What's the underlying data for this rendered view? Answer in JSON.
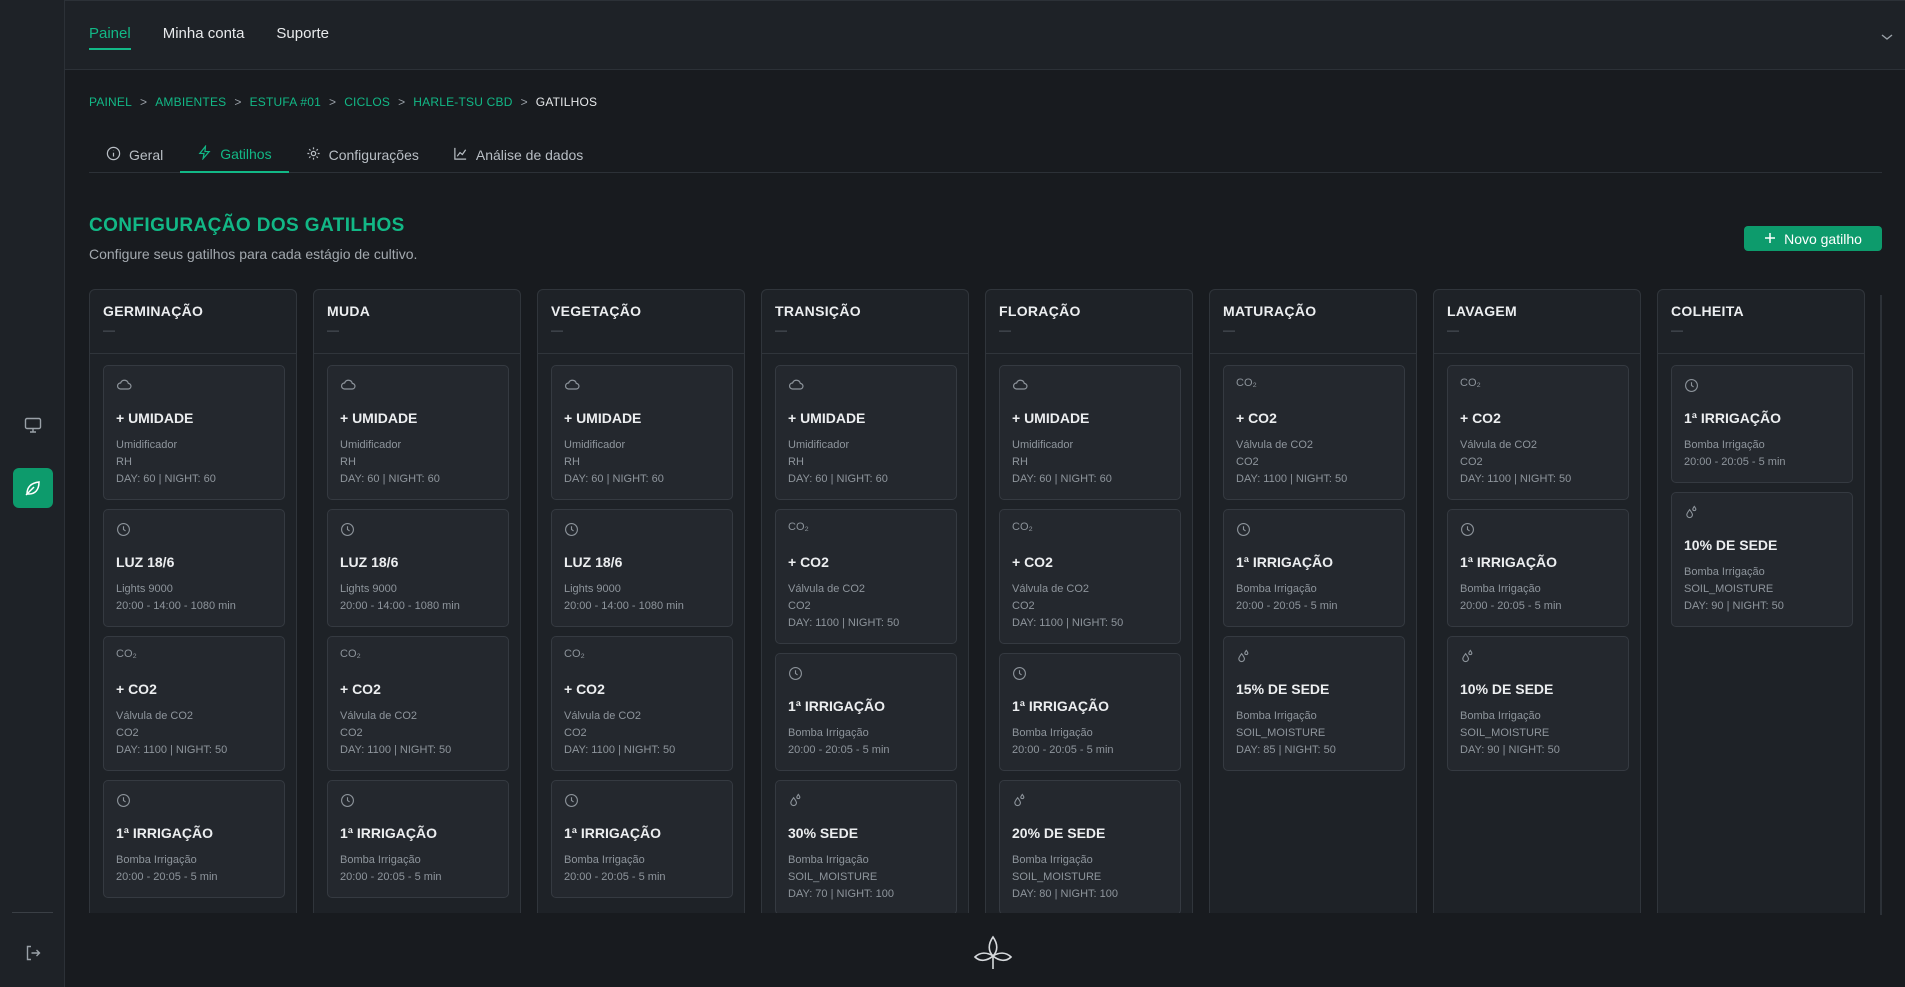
{
  "topnav": {
    "items": [
      "Painel",
      "Minha conta",
      "Suporte"
    ]
  },
  "breadcrumb": [
    "PAINEL",
    "AMBIENTES",
    "ESTUFA #01",
    "CICLOS",
    "HARLE-TSU CBD",
    "GATILHOS"
  ],
  "breadcrumb_sep": ">",
  "tabs": [
    "Geral",
    "Gatilhos",
    "Configurações",
    "Análise de dados"
  ],
  "page": {
    "title": "CONFIGURAÇÃO DOS GATILHOS",
    "subtitle": "Configure seus gatilhos para cada estágio de cultivo.",
    "new_button": "Novo gatilho"
  },
  "accent_color": "#12b886",
  "columns": [
    {
      "title": "GERMINAÇÃO",
      "dash": "—",
      "cards": [
        {
          "icon": "cloud-icon",
          "title": "+ UMIDADE",
          "lines": [
            "Umidificador",
            "RH",
            "DAY: 60 | NIGHT: 60"
          ]
        },
        {
          "icon": "clock-icon",
          "title": "LUZ 18/6",
          "lines": [
            "Lights 9000",
            "20:00 - 14:00 - 1080 min"
          ]
        },
        {
          "icon": "co2-icon",
          "icon_text": "CO₂",
          "title": "+ CO2",
          "lines": [
            "Válvula de CO2",
            "CO2",
            "DAY: 1100 | NIGHT: 50"
          ]
        },
        {
          "icon": "clock-icon",
          "title": "1ª IRRIGAÇÃO",
          "lines": [
            "Bomba Irrigação",
            "20:00 - 20:05 - 5 min"
          ]
        }
      ]
    },
    {
      "title": "MUDA",
      "dash": "—",
      "cards": [
        {
          "icon": "cloud-icon",
          "title": "+ UMIDADE",
          "lines": [
            "Umidificador",
            "RH",
            "DAY: 60 | NIGHT: 60"
          ]
        },
        {
          "icon": "clock-icon",
          "title": "LUZ 18/6",
          "lines": [
            "Lights 9000",
            "20:00 - 14:00 - 1080 min"
          ]
        },
        {
          "icon": "co2-icon",
          "icon_text": "CO₂",
          "title": "+ CO2",
          "lines": [
            "Válvula de CO2",
            "CO2",
            "DAY: 1100 | NIGHT: 50"
          ]
        },
        {
          "icon": "clock-icon",
          "title": "1ª IRRIGAÇÃO",
          "lines": [
            "Bomba Irrigação",
            "20:00 - 20:05 - 5 min"
          ]
        }
      ]
    },
    {
      "title": "VEGETAÇÃO",
      "dash": "—",
      "cards": [
        {
          "icon": "cloud-icon",
          "title": "+ UMIDADE",
          "lines": [
            "Umidificador",
            "RH",
            "DAY: 60 | NIGHT: 60"
          ]
        },
        {
          "icon": "clock-icon",
          "title": "LUZ 18/6",
          "lines": [
            "Lights 9000",
            "20:00 - 14:00 - 1080 min"
          ]
        },
        {
          "icon": "co2-icon",
          "icon_text": "CO₂",
          "title": "+ CO2",
          "lines": [
            "Válvula de CO2",
            "CO2",
            "DAY: 1100 | NIGHT: 50"
          ]
        },
        {
          "icon": "clock-icon",
          "title": "1ª IRRIGAÇÃO",
          "lines": [
            "Bomba Irrigação",
            "20:00 - 20:05 - 5 min"
          ]
        }
      ]
    },
    {
      "title": "TRANSIÇÃO",
      "dash": "—",
      "cards": [
        {
          "icon": "cloud-icon",
          "title": "+ UMIDADE",
          "lines": [
            "Umidificador",
            "RH",
            "DAY: 60 | NIGHT: 60"
          ]
        },
        {
          "icon": "co2-icon",
          "icon_text": "CO₂",
          "title": "+ CO2",
          "lines": [
            "Válvula de CO2",
            "CO2",
            "DAY: 1100 | NIGHT: 50"
          ]
        },
        {
          "icon": "clock-icon",
          "title": "1ª IRRIGAÇÃO",
          "lines": [
            "Bomba Irrigação",
            "20:00 - 20:05 - 5 min"
          ]
        },
        {
          "icon": "drops-icon",
          "title": "30% SEDE",
          "lines": [
            "Bomba Irrigação",
            "SOIL_MOISTURE",
            "DAY: 70 | NIGHT: 100"
          ]
        }
      ]
    },
    {
      "title": "FLORAÇÃO",
      "dash": "—",
      "cards": [
        {
          "icon": "cloud-icon",
          "title": "+ UMIDADE",
          "lines": [
            "Umidificador",
            "RH",
            "DAY: 60 | NIGHT: 60"
          ]
        },
        {
          "icon": "co2-icon",
          "icon_text": "CO₂",
          "title": "+ CO2",
          "lines": [
            "Válvula de CO2",
            "CO2",
            "DAY: 1100 | NIGHT: 50"
          ]
        },
        {
          "icon": "clock-icon",
          "title": "1ª IRRIGAÇÃO",
          "lines": [
            "Bomba Irrigação",
            "20:00 - 20:05 - 5 min"
          ]
        },
        {
          "icon": "drops-icon",
          "title": "20% DE SEDE",
          "lines": [
            "Bomba Irrigação",
            "SOIL_MOISTURE",
            "DAY: 80 | NIGHT: 100"
          ]
        }
      ]
    },
    {
      "title": "MATURAÇÃO",
      "dash": "—",
      "cards": [
        {
          "icon": "co2-icon",
          "icon_text": "CO₂",
          "title": "+ CO2",
          "lines": [
            "Válvula de CO2",
            "CO2",
            "DAY: 1100 | NIGHT: 50"
          ]
        },
        {
          "icon": "clock-icon",
          "title": "1ª IRRIGAÇÃO",
          "lines": [
            "Bomba Irrigação",
            "20:00 - 20:05 - 5 min"
          ]
        },
        {
          "icon": "drops-icon",
          "title": "15% DE SEDE",
          "lines": [
            "Bomba Irrigação",
            "SOIL_MOISTURE",
            "DAY: 85 | NIGHT: 50"
          ]
        }
      ]
    },
    {
      "title": "LAVAGEM",
      "dash": "—",
      "cards": [
        {
          "icon": "co2-icon",
          "icon_text": "CO₂",
          "title": "+ CO2",
          "lines": [
            "Válvula de CO2",
            "CO2",
            "DAY: 1100 | NIGHT: 50"
          ]
        },
        {
          "icon": "clock-icon",
          "title": "1ª IRRIGAÇÃO",
          "lines": [
            "Bomba Irrigação",
            "20:00 - 20:05 - 5 min"
          ]
        },
        {
          "icon": "drops-icon",
          "title": "10% DE SEDE",
          "lines": [
            "Bomba Irrigação",
            "SOIL_MOISTURE",
            "DAY: 90 | NIGHT: 50"
          ]
        }
      ]
    },
    {
      "title": "COLHEITA",
      "dash": "—",
      "cards": [
        {
          "icon": "clock-icon",
          "title": "1ª IRRIGAÇÃO",
          "lines": [
            "Bomba Irrigação",
            "20:00 - 20:05 - 5 min"
          ]
        },
        {
          "icon": "drops-icon",
          "title": "10% DE SEDE",
          "lines": [
            "Bomba Irrigação",
            "SOIL_MOISTURE",
            "DAY: 90 | NIGHT: 50"
          ]
        }
      ]
    }
  ]
}
